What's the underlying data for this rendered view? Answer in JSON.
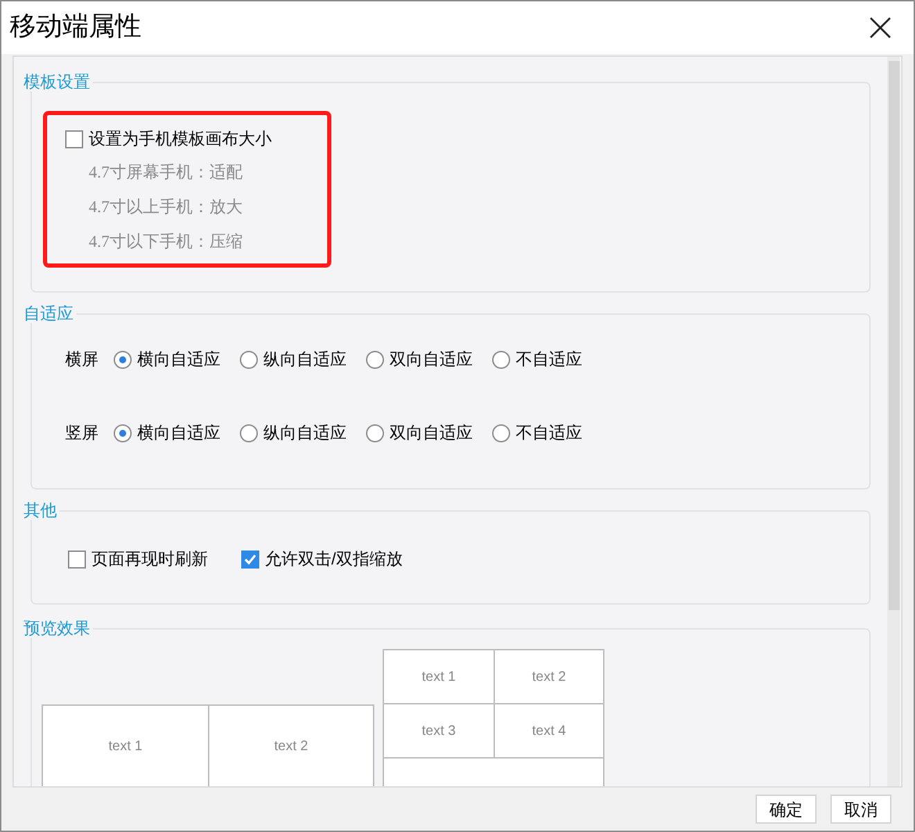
{
  "window": {
    "title": "移动端属性"
  },
  "template_settings": {
    "label": "模板设置",
    "highlighted": true,
    "checkbox": {
      "label": "设置为手机模板画布大小",
      "checked": false
    },
    "notes": [
      "4.7寸屏幕手机：适配",
      "4.7寸以上手机：放大",
      "4.7寸以下手机：压缩"
    ]
  },
  "adaptive": {
    "label": "自适应",
    "rows": [
      {
        "label": "横屏",
        "options": [
          {
            "label": "横向自适应",
            "selected": true
          },
          {
            "label": "纵向自适应",
            "selected": false
          },
          {
            "label": "双向自适应",
            "selected": false
          },
          {
            "label": "不自适应",
            "selected": false
          }
        ]
      },
      {
        "label": "竖屏",
        "options": [
          {
            "label": "横向自适应",
            "selected": true
          },
          {
            "label": "纵向自适应",
            "selected": false
          },
          {
            "label": "双向自适应",
            "selected": false
          },
          {
            "label": "不自适应",
            "selected": false
          }
        ]
      }
    ]
  },
  "other": {
    "label": "其他",
    "checkboxes": [
      {
        "label": "页面再现时刷新",
        "checked": false
      },
      {
        "label": "允许双击/双指缩放",
        "checked": true
      }
    ]
  },
  "preview": {
    "label": "预览效果",
    "landscape_table": [
      "text 1",
      "text 2"
    ],
    "portrait_table": [
      "text 1",
      "text 2",
      "text 3",
      "text 4"
    ]
  },
  "buttons": [
    "确定",
    "取消"
  ]
}
